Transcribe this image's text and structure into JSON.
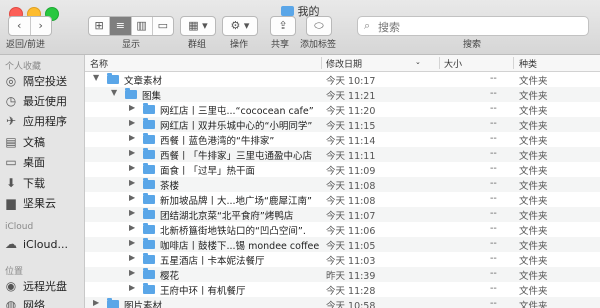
{
  "window": {
    "title": "我的"
  },
  "toolbar": {
    "back_label": "返回/前进",
    "view_label": "显示",
    "group_label": "群组",
    "action_label": "操作",
    "share_label": "共享",
    "tag_label": "添加标签",
    "search_label": "搜索",
    "search_placeholder": "搜索"
  },
  "sidebar": {
    "favorites_header": "个人收藏",
    "favorites": [
      {
        "label": "隔空投送",
        "icon": "airdrop-icon"
      },
      {
        "label": "最近使用",
        "icon": "clock-icon"
      },
      {
        "label": "应用程序",
        "icon": "applications-icon"
      },
      {
        "label": "文稿",
        "icon": "document-icon"
      },
      {
        "label": "桌面",
        "icon": "desktop-icon"
      },
      {
        "label": "下载",
        "icon": "download-icon"
      },
      {
        "label": "坚果云",
        "icon": "folder-icon"
      }
    ],
    "icloud_header": "iCloud",
    "icloud": [
      {
        "label": "iCloud...",
        "icon": "cloud-icon"
      }
    ],
    "locations_header": "位置",
    "locations": [
      {
        "label": "远程光盘",
        "icon": "disc-icon"
      },
      {
        "label": "网络",
        "icon": "network-icon"
      }
    ]
  },
  "columns": {
    "name": "名称",
    "date": "修改日期",
    "size": "大小",
    "kind": "种类"
  },
  "rows": [
    {
      "name": "文章素材",
      "date": "今天 10:17",
      "size": "--",
      "kind": "文件夹",
      "expanded": true
    },
    {
      "name": "图集",
      "date": "今天 11:21",
      "size": "--",
      "kind": "文件夹",
      "expanded": true
    },
    {
      "name": "网红店丨三里屯...“cococean cafe”",
      "date": "今天 11:20",
      "size": "--",
      "kind": "文件夹",
      "expanded": false
    },
    {
      "name": "网红店丨双井乐城中心的“小明同学”",
      "date": "今天 11:15",
      "size": "--",
      "kind": "文件夹",
      "expanded": false
    },
    {
      "name": "西餐丨蓝色港湾的“牛排家”",
      "date": "今天 11:14",
      "size": "--",
      "kind": "文件夹",
      "expanded": false
    },
    {
      "name": "西餐丨「牛排家」三里屯通盈中心店",
      "date": "今天 11:11",
      "size": "--",
      "kind": "文件夹",
      "expanded": false
    },
    {
      "name": "面食丨「过早」热干面",
      "date": "今天 11:09",
      "size": "--",
      "kind": "文件夹",
      "expanded": false
    },
    {
      "name": "茶楼",
      "date": "今天 11:08",
      "size": "--",
      "kind": "文件夹",
      "expanded": false
    },
    {
      "name": "新加坡品牌丨大...地广场“鹿犀江南”",
      "date": "今天 11:08",
      "size": "--",
      "kind": "文件夹",
      "expanded": false
    },
    {
      "name": "团结湖北京菜“北平食府”烤鸭店",
      "date": "今天 11:07",
      "size": "--",
      "kind": "文件夹",
      "expanded": false
    },
    {
      "name": "北新桥簋街地铁站口的“凹凸空间”.",
      "date": "今天 11:06",
      "size": "--",
      "kind": "文件夹",
      "expanded": false
    },
    {
      "name": "咖啡店丨鼓楼下...锡 mondee coffee",
      "date": "今天 11:05",
      "size": "--",
      "kind": "文件夹",
      "expanded": false
    },
    {
      "name": "五星酒店丨卡本妮法餐厅",
      "date": "今天 11:03",
      "size": "--",
      "kind": "文件夹",
      "expanded": false
    },
    {
      "name": "樱花",
      "date": "昨天 11:39",
      "size": "--",
      "kind": "文件夹",
      "expanded": false
    },
    {
      "name": "王府中环丨有机餐厅",
      "date": "今天 11:28",
      "size": "--",
      "kind": "文件夹",
      "expanded": false
    },
    {
      "name": "图片素材",
      "date": "今天 10:58",
      "size": "--",
      "kind": "文件夹",
      "expanded": false
    }
  ]
}
